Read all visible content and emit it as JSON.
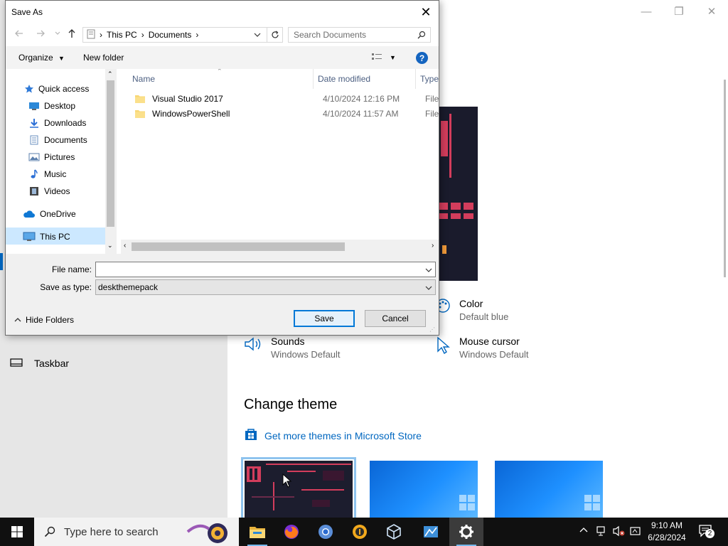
{
  "settings": {
    "sidebar": {
      "taskbar_label": "Taskbar"
    },
    "tiles": [
      {
        "title": "Color",
        "subtitle": "Default blue"
      },
      {
        "title": "Sounds",
        "subtitle": "Windows Default"
      },
      {
        "title": "Mouse cursor",
        "subtitle": "Windows Default"
      }
    ],
    "change_theme_heading": "Change theme",
    "store_link": "Get more themes in Microsoft Store",
    "window_controls": {
      "minimize": "—",
      "maximize": "❐",
      "close": "✕"
    }
  },
  "dialog": {
    "title": "Save As",
    "close_glyph": "✕",
    "breadcrumb": [
      "This PC",
      "Documents"
    ],
    "search_placeholder": "Search Documents",
    "toolbar": {
      "organize": "Organize",
      "new_folder": "New folder"
    },
    "nav_items": [
      "Quick access",
      "Desktop",
      "Downloads",
      "Documents",
      "Pictures",
      "Music",
      "Videos",
      "OneDrive",
      "This PC"
    ],
    "columns": {
      "name": "Name",
      "date": "Date modified",
      "type": "Type"
    },
    "files": [
      {
        "name": "Visual Studio 2017",
        "date": "4/10/2024 12:16 PM",
        "type": "File folder"
      },
      {
        "name": "WindowsPowerShell",
        "date": "4/10/2024 11:57 AM",
        "type": "File folder"
      }
    ],
    "file_name_label": "File name:",
    "file_name_value": "",
    "save_as_type_label": "Save as type:",
    "save_as_type_value": "deskthemepack",
    "hide_folders": "Hide Folders",
    "save_button": "Save",
    "cancel_button": "Cancel"
  },
  "taskbar": {
    "search_placeholder": "Type here to search",
    "time": "9:10 AM",
    "date": "6/28/2024",
    "notification_count": "2"
  },
  "colors": {
    "accent": "#0067c0",
    "selection": "#cce8ff",
    "taskbar": "#101010"
  }
}
